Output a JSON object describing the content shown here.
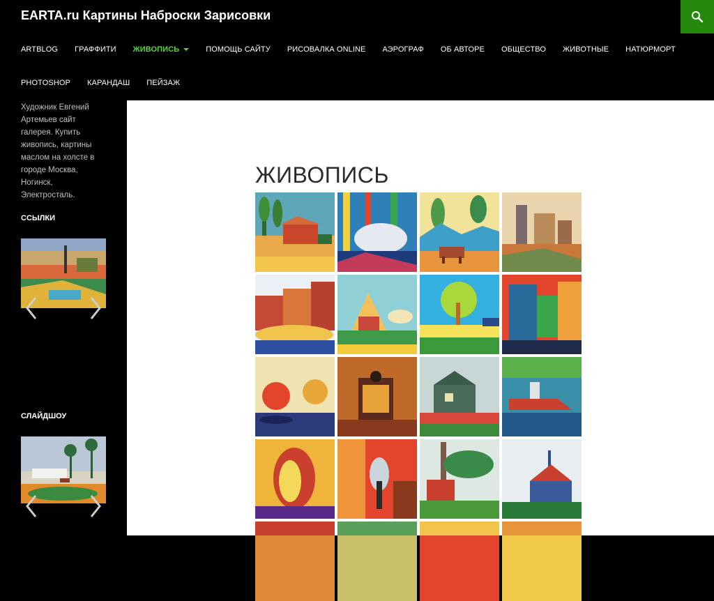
{
  "site": {
    "title": "EARTA.ru Картины Наброски Зарисовки"
  },
  "nav": {
    "row1": [
      {
        "label": "ARTBLOG",
        "active": false
      },
      {
        "label": "ГРАФФИТИ",
        "active": false
      },
      {
        "label": "ЖИВОПИСЬ",
        "active": true
      },
      {
        "label": "ПОМОЩЬ САЙТУ",
        "active": false
      },
      {
        "label": "РИСОВАЛКА ONLINE",
        "active": false
      },
      {
        "label": "АЭРОГРАФ",
        "active": false
      },
      {
        "label": "ОБ АВТОРЕ",
        "active": false
      },
      {
        "label": "ОБЩЕСТВО",
        "active": false
      },
      {
        "label": "ЖИВОТНЫЕ",
        "active": false
      },
      {
        "label": "НАТЮРМОРТ",
        "active": false
      }
    ],
    "row2": [
      {
        "label": "PHOTOSHOP",
        "active": false
      },
      {
        "label": "КАРАНДАШ",
        "active": false
      },
      {
        "label": "ПЕЙЗАЖ",
        "active": false
      }
    ]
  },
  "sidebar": {
    "description": "Художник Евгений Артемьев сайт галерея. Купить живопись, картины маслом на холсте в городе Москва, Ногинск, Электросталь.",
    "links_title": "ССЫЛКИ",
    "slideshow_title": "СЛАЙДШОУ"
  },
  "content": {
    "title": "ЖИВОПИСЬ"
  },
  "colors": {
    "accent": "#24890d",
    "active_nav": "#55d737",
    "content_bg": "#ffffff"
  },
  "icons": {
    "search": "search-icon",
    "prev": "chevron-left-icon",
    "next": "chevron-right-icon"
  }
}
